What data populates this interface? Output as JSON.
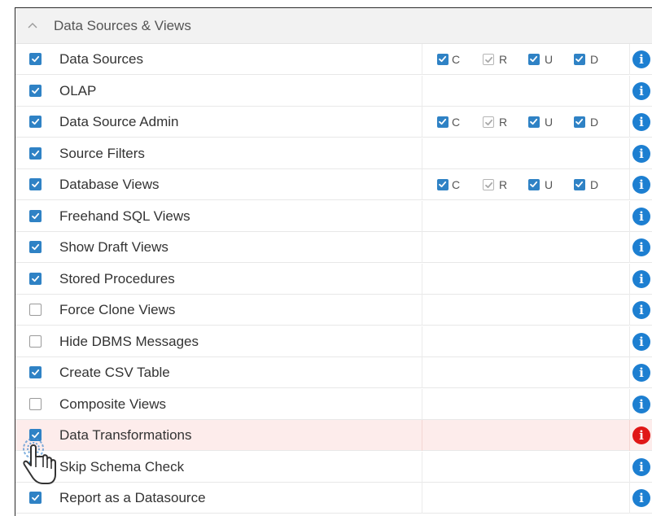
{
  "section": {
    "title": "Data Sources & Views",
    "expanded": true
  },
  "crud_labels": [
    "C",
    "R",
    "U",
    "D"
  ],
  "info_glyph": "i",
  "colors": {
    "checkbox": "#2f82c5",
    "info": "#1d7fd1",
    "info_alert": "#e01717",
    "alert_row_bg": "#fdeceb"
  },
  "rows": [
    {
      "label": "Data Sources",
      "checked": true,
      "crud": true,
      "alert": false
    },
    {
      "label": "OLAP",
      "checked": true,
      "crud": false,
      "alert": false
    },
    {
      "label": "Data Source Admin",
      "checked": true,
      "crud": true,
      "alert": false
    },
    {
      "label": "Source Filters",
      "checked": true,
      "crud": false,
      "alert": false
    },
    {
      "label": "Database Views",
      "checked": true,
      "crud": true,
      "alert": false
    },
    {
      "label": "Freehand SQL Views",
      "checked": true,
      "crud": false,
      "alert": false
    },
    {
      "label": "Show Draft Views",
      "checked": true,
      "crud": false,
      "alert": false
    },
    {
      "label": "Stored Procedures",
      "checked": true,
      "crud": false,
      "alert": false
    },
    {
      "label": "Force Clone Views",
      "checked": false,
      "crud": false,
      "alert": false
    },
    {
      "label": "Hide DBMS Messages",
      "checked": false,
      "crud": false,
      "alert": false
    },
    {
      "label": "Create CSV Table",
      "checked": true,
      "crud": false,
      "alert": false
    },
    {
      "label": "Composite Views",
      "checked": false,
      "crud": false,
      "alert": false
    },
    {
      "label": "Data Transformations",
      "checked": true,
      "crud": false,
      "alert": true
    },
    {
      "label": "Skip Schema Check",
      "checked": true,
      "crud": false,
      "alert": false
    },
    {
      "label": "Report as a Datasource",
      "checked": true,
      "crud": false,
      "alert": false
    }
  ]
}
